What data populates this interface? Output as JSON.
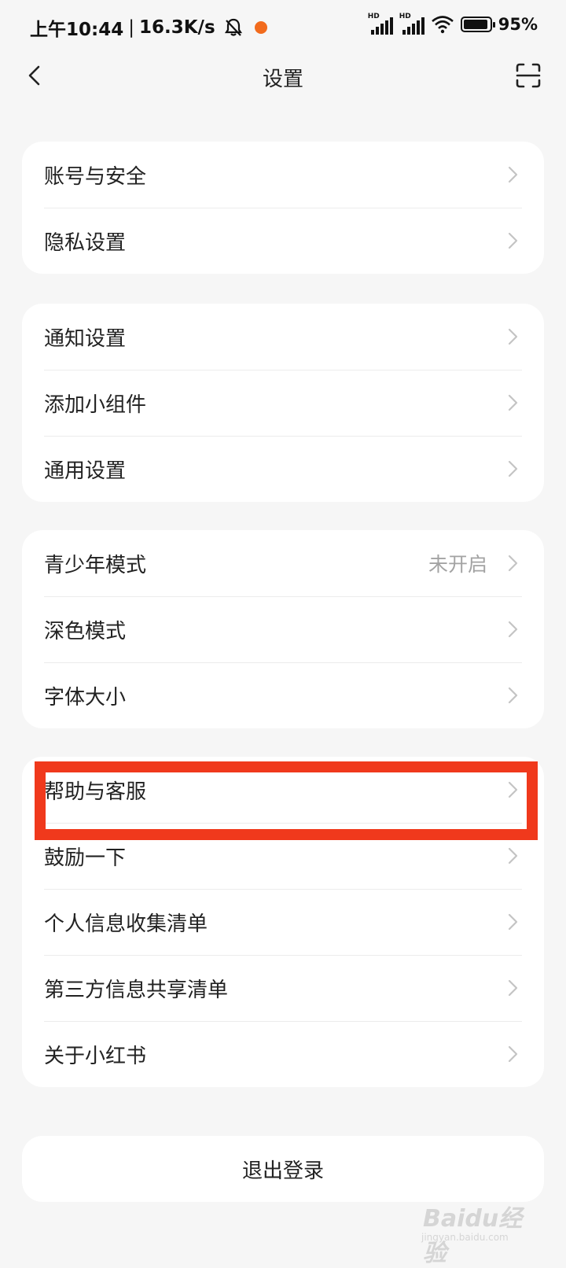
{
  "status_bar": {
    "time": "上午10:44",
    "speed": "16.3K/s",
    "sim1_label": "HD",
    "sim2_label": "HD",
    "battery": "95%",
    "battery_level": 0.95,
    "icons": [
      "bell-off-icon",
      "app-notification-dot",
      "signal-icon",
      "wifi-icon",
      "battery-icon"
    ]
  },
  "header": {
    "title": "设置",
    "back_icon": "chevron-left-icon",
    "scan_icon": "scan-icon"
  },
  "groups": [
    {
      "items": [
        {
          "label": "账号与安全",
          "value": ""
        },
        {
          "label": "隐私设置",
          "value": ""
        }
      ]
    },
    {
      "items": [
        {
          "label": "通知设置",
          "value": ""
        },
        {
          "label": "添加小组件",
          "value": ""
        },
        {
          "label": "通用设置",
          "value": ""
        }
      ]
    },
    {
      "items": [
        {
          "label": "青少年模式",
          "value": "未开启"
        },
        {
          "label": "深色模式",
          "value": ""
        },
        {
          "label": "字体大小",
          "value": ""
        }
      ]
    },
    {
      "items": [
        {
          "label": "帮助与客服",
          "value": ""
        },
        {
          "label": "鼓励一下",
          "value": ""
        },
        {
          "label": "个人信息收集清单",
          "value": ""
        },
        {
          "label": "第三方信息共享清单",
          "value": ""
        },
        {
          "label": "关于小红书",
          "value": ""
        }
      ]
    }
  ],
  "logout_label": "退出登录",
  "highlight_color": "#f0391c",
  "watermark": {
    "text": "Baidu经验",
    "sub": "jingyan.baidu.com"
  }
}
